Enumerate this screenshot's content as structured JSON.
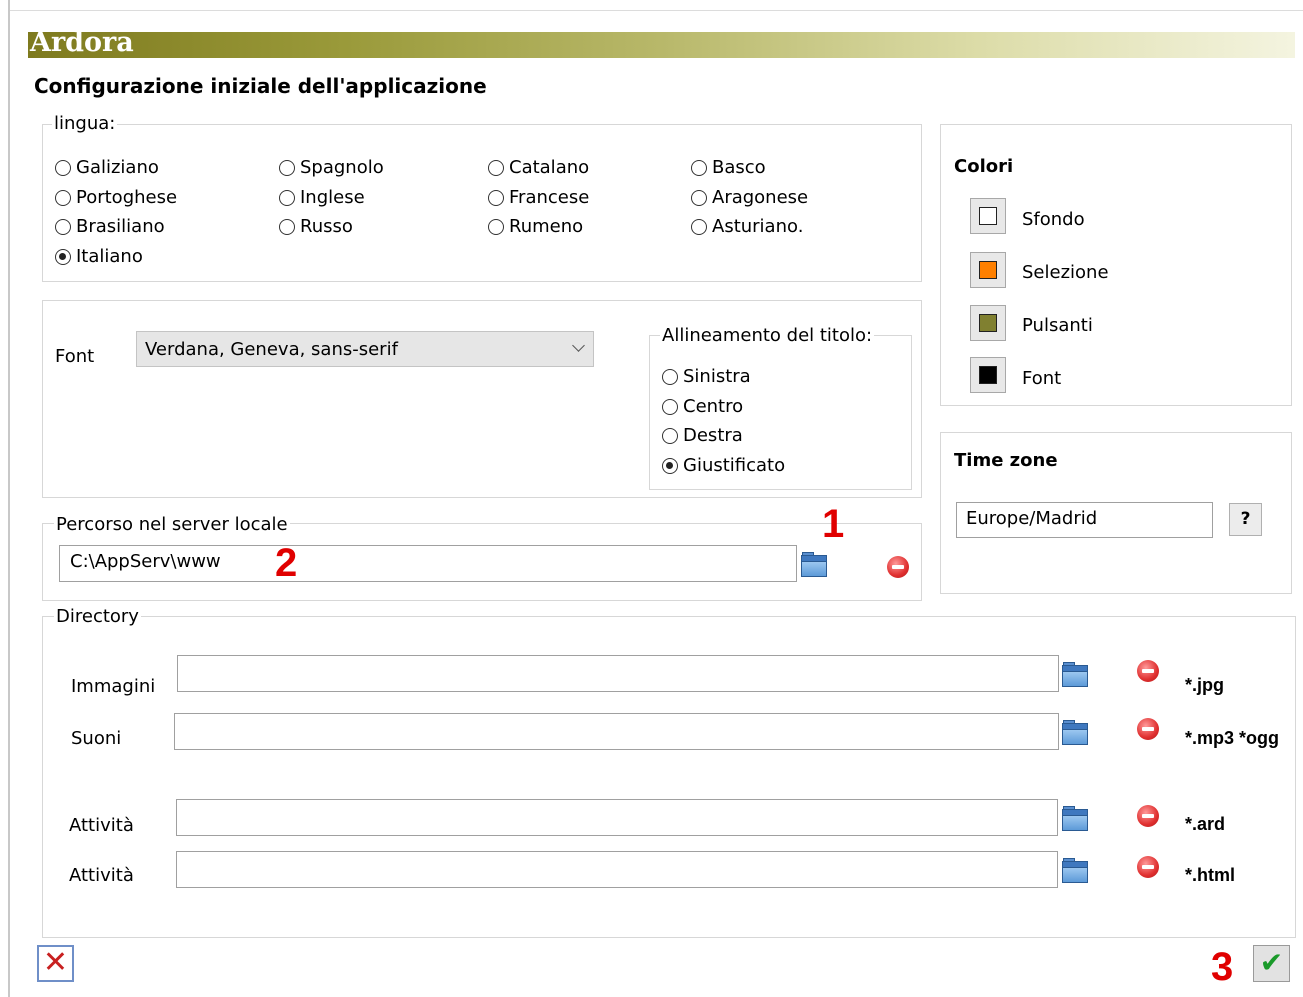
{
  "app": {
    "title": "Ardora",
    "heading": "Configurazione iniziale dell'applicazione"
  },
  "language": {
    "legend": "lingua:",
    "options": [
      "Galiziano",
      "Spagnolo",
      "Catalano",
      "Basco",
      "Portoghese",
      "Inglese",
      "Francese",
      "Aragonese",
      "Brasiliano",
      "Russo",
      "Rumeno",
      "Asturiano.",
      "Italiano"
    ],
    "selected": "Italiano"
  },
  "font": {
    "label": "Font",
    "value": "Verdana, Geneva, sans-serif"
  },
  "alignment": {
    "legend": "Allineamento del titolo:",
    "options": [
      "Sinistra",
      "Centro",
      "Destra",
      "Giustificato"
    ],
    "selected": "Giustificato"
  },
  "colors": {
    "title": "Colori",
    "items": [
      {
        "label": "Sfondo",
        "color": "#ffffff"
      },
      {
        "label": "Selezione",
        "color": "#ff8000"
      },
      {
        "label": "Pulsanti",
        "color": "#808030"
      },
      {
        "label": "Font",
        "color": "#000000"
      }
    ]
  },
  "timezone": {
    "title": "Time zone",
    "value": "Europe/Madrid",
    "help_label": "?"
  },
  "server": {
    "legend": "Percorso nel server locale",
    "path": "C:\\AppServ\\www"
  },
  "directory": {
    "legend": "Directory",
    "rows": [
      {
        "label": "Immagini",
        "value": "",
        "ext": "*.jpg"
      },
      {
        "label": "Suoni",
        "value": "",
        "ext": "*.mp3 *ogg"
      },
      {
        "label": "Attività",
        "value": "",
        "ext": "*.ard"
      },
      {
        "label": "Attività",
        "value": "",
        "ext": "*.html"
      }
    ]
  },
  "annotations": [
    "1",
    "2",
    "3"
  ],
  "icons": {
    "folder": "folder-icon",
    "remove": "remove-icon",
    "cancel": "close-icon",
    "ok": "check-icon"
  }
}
